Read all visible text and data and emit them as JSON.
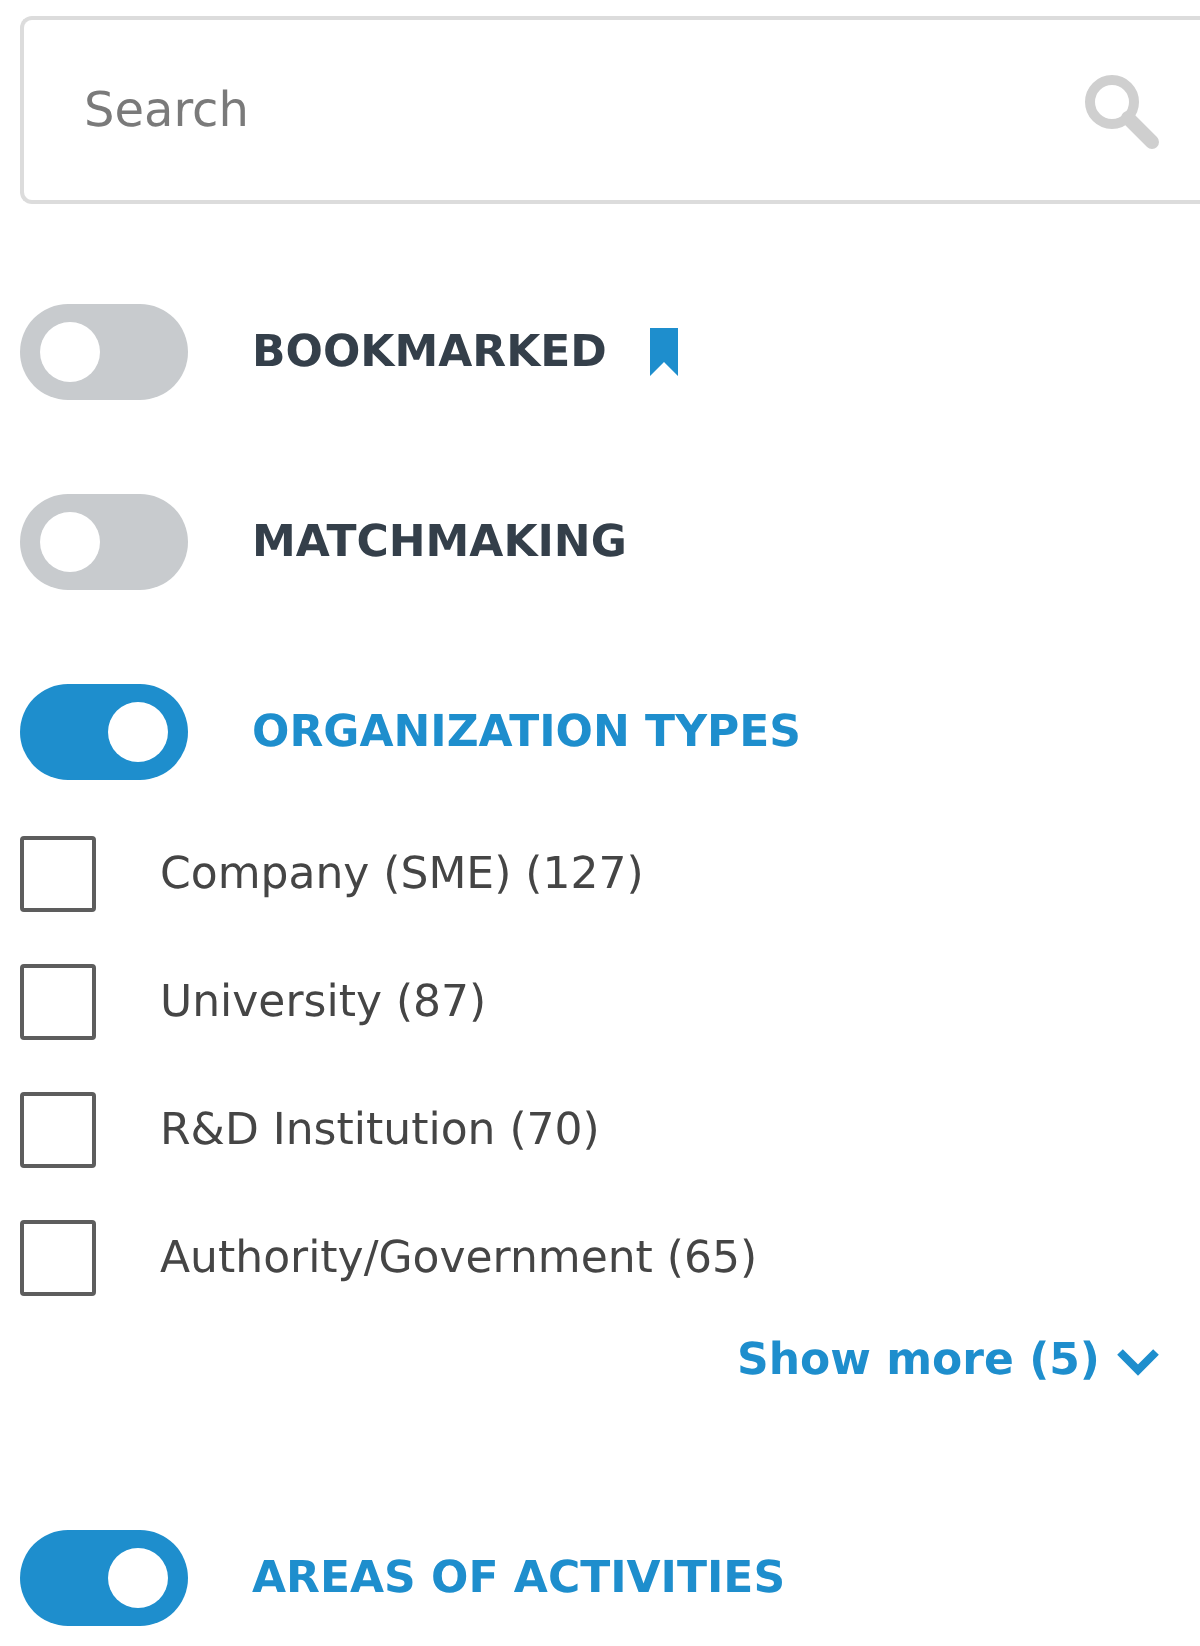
{
  "search": {
    "placeholder": "Search"
  },
  "filters": [
    {
      "label": "BOOKMARKED",
      "on": false,
      "bookmark": true
    },
    {
      "label": "MATCHMAKING",
      "on": false
    },
    {
      "label": "ORGANIZATION TYPES",
      "on": true,
      "options": [
        {
          "label": "Company (SME) (127)",
          "checked": false
        },
        {
          "label": "University (87)",
          "checked": false
        },
        {
          "label": "R&D Institution (70)",
          "checked": false
        },
        {
          "label": "Authority/Government (65)",
          "checked": false
        }
      ],
      "show_more": "Show more (5)"
    },
    {
      "label": "AREAS OF ACTIVITIES",
      "on": true
    }
  ]
}
